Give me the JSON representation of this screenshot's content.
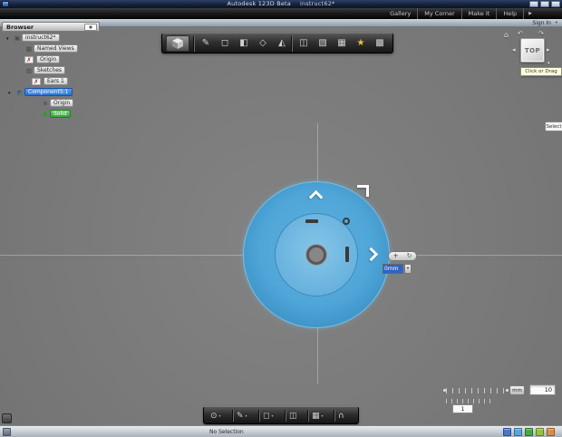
{
  "titlebar": {
    "app_title": "Autodesk 123D Beta",
    "doc_title": "instruct62*"
  },
  "menubar": {
    "items": [
      "Gallery",
      "My Corner",
      "Make It",
      "Help"
    ],
    "more_arrow": "▶"
  },
  "topstrip": {
    "sign_in": "Sign In"
  },
  "browser": {
    "title": "Browser",
    "items": [
      {
        "label": "instruct62*",
        "icon": "▣"
      },
      {
        "label": "Named Views",
        "icon": "▦"
      },
      {
        "label": "Origin",
        "icon": "✗"
      },
      {
        "label": "Sketches",
        "icon": "▨"
      },
      {
        "label": "Ears 1",
        "icon": "✗"
      },
      {
        "label": "Component5:1",
        "icon": "◩"
      },
      {
        "label": "Origin",
        "icon": "⊕"
      },
      {
        "label": "Solid",
        "icon": "◼"
      }
    ]
  },
  "toolbar": {
    "icons": [
      {
        "name": "sketch-icon",
        "glyph": "✎"
      },
      {
        "name": "primitive-box-icon",
        "glyph": "◻"
      },
      {
        "name": "cylinder-icon",
        "glyph": "◧"
      },
      {
        "name": "move-icon",
        "glyph": "◇"
      },
      {
        "name": "revolve-icon",
        "glyph": "◭"
      },
      {
        "name": "combine-icon",
        "glyph": "◫"
      },
      {
        "name": "pattern-icon",
        "glyph": "▧"
      },
      {
        "name": "grid-icon",
        "glyph": "▦"
      },
      {
        "name": "material-icon",
        "glyph": "★"
      },
      {
        "name": "snap-icon",
        "glyph": "▩"
      }
    ]
  },
  "viewcube": {
    "face": "TOP",
    "tooltip": "Click or Drag"
  },
  "canvas": {
    "select_label": "Select",
    "dimension_value": "0mm"
  },
  "bottom_toolbar": {
    "icons": [
      {
        "name": "sketch-circle-icon",
        "glyph": "⊙"
      },
      {
        "name": "pencil-icon",
        "glyph": "✎"
      },
      {
        "name": "primitive-icon",
        "glyph": "◻"
      },
      {
        "name": "measure-icon",
        "glyph": "◫"
      },
      {
        "name": "grid-snap-icon",
        "glyph": "▦"
      },
      {
        "name": "magnet-icon",
        "glyph": "∩"
      }
    ]
  },
  "scale": {
    "unit": "mm",
    "value": "10",
    "sub_value": "1"
  },
  "statusbar": {
    "text": "No Selection",
    "indicators": [
      "#4a78c8",
      "#58a8d8",
      "#48a848",
      "#98c040",
      "#d89040"
    ]
  },
  "icons": {
    "dropdown": "▾",
    "expander_open": "▾",
    "home": "⌂",
    "rotate_left": "↶",
    "rotate_right": "↷",
    "arrow_left": "◂",
    "arrow_right": "▸",
    "plus": "+",
    "rotate": "↻"
  }
}
